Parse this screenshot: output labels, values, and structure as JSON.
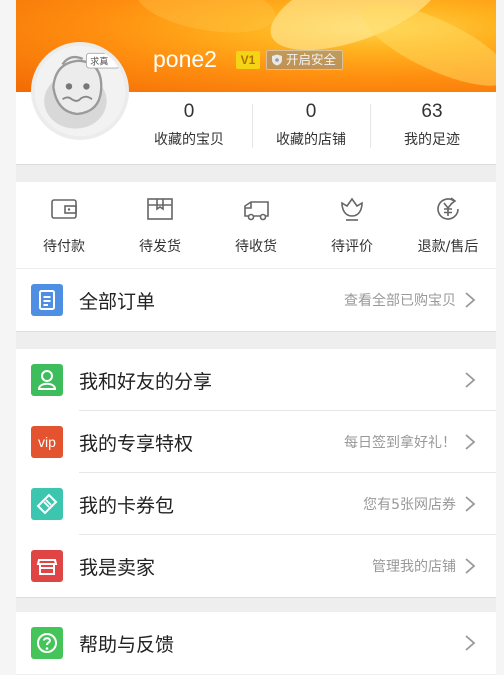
{
  "profile": {
    "username": "pone2",
    "vip_level": "V1",
    "safety_label": "开启安全"
  },
  "stats": [
    {
      "count": "0",
      "label": "收藏的宝贝"
    },
    {
      "count": "0",
      "label": "收藏的店铺"
    },
    {
      "count": "63",
      "label": "我的足迹"
    }
  ],
  "order_status": [
    {
      "label": "待付款",
      "icon": "wallet-icon"
    },
    {
      "label": "待发货",
      "icon": "package-icon"
    },
    {
      "label": "待收货",
      "icon": "truck-icon"
    },
    {
      "label": "待评价",
      "icon": "flower-icon"
    },
    {
      "label": "退款/售后",
      "icon": "refund-icon"
    }
  ],
  "all_orders": {
    "title": "全部订单",
    "hint": "查看全部已购宝贝",
    "icon": "order-list-icon",
    "color": "#4e8ee3"
  },
  "menu": [
    {
      "title": "我和好友的分享",
      "hint": "",
      "icon": "share-friend-icon",
      "color": "#3dbd5c"
    },
    {
      "title": "我的专享特权",
      "hint": "每日签到拿好礼！",
      "icon": "vip-icon",
      "icon_text": "vip",
      "color": "#e3532f"
    },
    {
      "title": "我的卡券包",
      "hint": "您有5张网店券",
      "icon": "ticket-icon",
      "color": "#3cc6b0"
    },
    {
      "title": "我是卖家",
      "hint": "管理我的店铺",
      "icon": "shop-icon",
      "color": "#e04545"
    }
  ],
  "help": {
    "title": "帮助与反馈",
    "hint": "",
    "icon": "help-icon",
    "color": "#45c45a"
  },
  "colors": {
    "accent": "#ff8f10",
    "icon_gray": "#666666"
  }
}
